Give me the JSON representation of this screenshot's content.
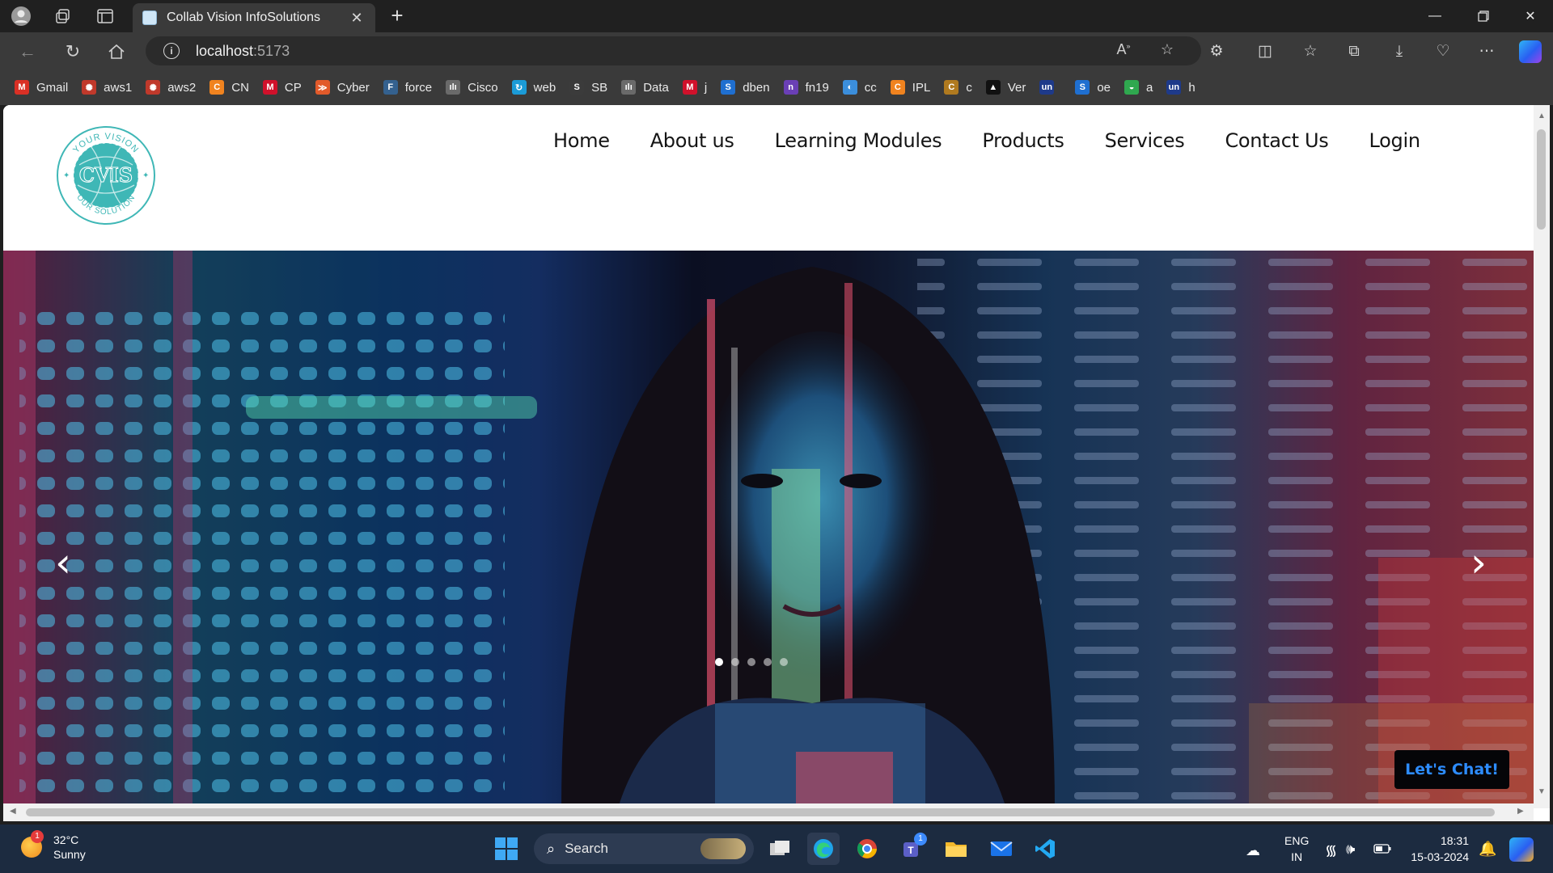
{
  "browser": {
    "tab_title": "Collab Vision InfoSolutions",
    "url_host": "localhost",
    "url_port": ":5173",
    "bookmarks": [
      {
        "label": "Gmail",
        "color": "#d93025",
        "glyph": "M"
      },
      {
        "label": "aws1",
        "color": "#c0392b",
        "glyph": "✺"
      },
      {
        "label": "aws2",
        "color": "#c0392b",
        "glyph": "✺"
      },
      {
        "label": "CN",
        "color": "#f0831f",
        "glyph": "C"
      },
      {
        "label": "CP",
        "color": "#d0112b",
        "glyph": "M"
      },
      {
        "label": "Cyber",
        "color": "#e25a2a",
        "glyph": "≫"
      },
      {
        "label": "force",
        "color": "#34618f",
        "glyph": "F"
      },
      {
        "label": "Cisco",
        "color": "#6a6a6a",
        "glyph": "ılı"
      },
      {
        "label": "web",
        "color": "#1b9bd7",
        "glyph": "↻"
      },
      {
        "label": "SB",
        "color": "#3b3b3b",
        "glyph": "S"
      },
      {
        "label": "Data",
        "color": "#6a6a6a",
        "glyph": "ılı"
      },
      {
        "label": "j",
        "color": "#d0112b",
        "glyph": "M"
      },
      {
        "label": "dben",
        "color": "#1f6fd0",
        "glyph": "S"
      },
      {
        "label": "fn19",
        "color": "#6a3fb5",
        "glyph": "n"
      },
      {
        "label": "cc",
        "color": "#3b8edb",
        "glyph": "◐"
      },
      {
        "label": "IPL",
        "color": "#f0831f",
        "glyph": "C"
      },
      {
        "label": "c",
        "color": "#b07a1f",
        "glyph": "C"
      },
      {
        "label": "Ver",
        "color": "#111111",
        "glyph": "▲"
      },
      {
        "label": "",
        "color": "#1e3a8a",
        "glyph": "un"
      },
      {
        "label": "oe",
        "color": "#1f6fd0",
        "glyph": "S"
      },
      {
        "label": "a",
        "color": "#2fa84f",
        "glyph": "◒"
      },
      {
        "label": "h",
        "color": "#1e3a8a",
        "glyph": "un"
      }
    ]
  },
  "site": {
    "logo_text": "CVIS",
    "logo_arc_top": "YOUR VISION",
    "logo_arc_bottom": "OUR SOLUTION",
    "logo_color": "#3fb7b6",
    "nav": [
      "Home",
      "About us",
      "Learning Modules",
      "Products",
      "Services",
      "Contact Us",
      "Login"
    ],
    "hero_prev": "‹",
    "hero_next": "›",
    "carousel_dots": 5,
    "carousel_active": 0,
    "chat_label": "Let's Chat!",
    "chat_color": "#2d8cff"
  },
  "taskbar": {
    "temp": "32°C",
    "condition": "Sunny",
    "weather_badge": "1",
    "search_label": "Search",
    "lang_top": "ENG",
    "lang_bottom": "IN",
    "time": "18:31",
    "date": "15-03-2024",
    "teams_badge": "1"
  }
}
